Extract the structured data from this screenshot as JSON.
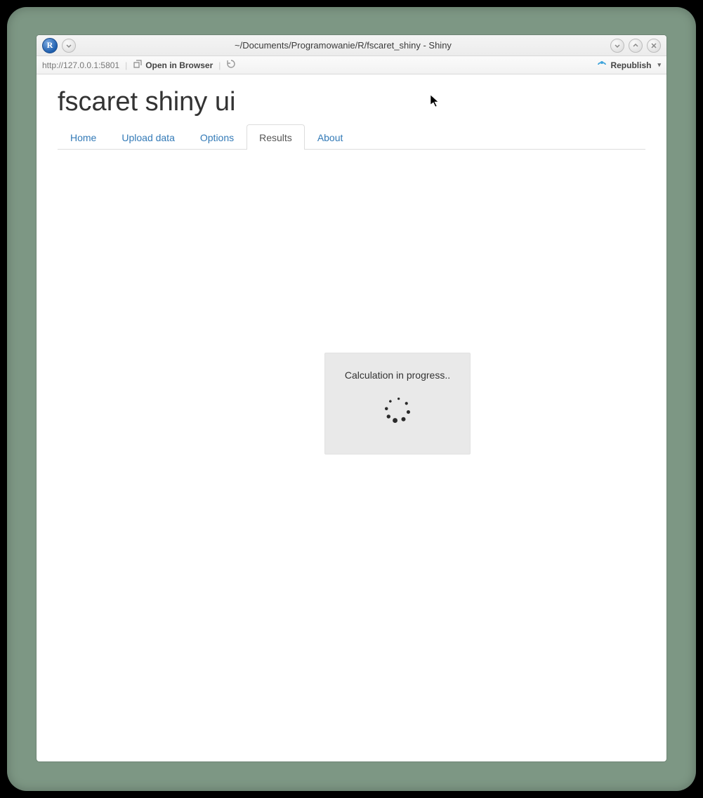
{
  "window": {
    "title": "~/Documents/Programowanie/R/fscaret_shiny - Shiny",
    "r_label": "R"
  },
  "toolbar": {
    "url": "http://127.0.0.1:5801",
    "open_in_browser": "Open in Browser",
    "republish": "Republish"
  },
  "page": {
    "title": "fscaret shiny ui",
    "tabs": [
      {
        "label": "Home"
      },
      {
        "label": "Upload data"
      },
      {
        "label": "Options"
      },
      {
        "label": "Results"
      },
      {
        "label": "About"
      }
    ],
    "active_tab": "Results"
  },
  "progress": {
    "text": "Calculation in progress.."
  }
}
